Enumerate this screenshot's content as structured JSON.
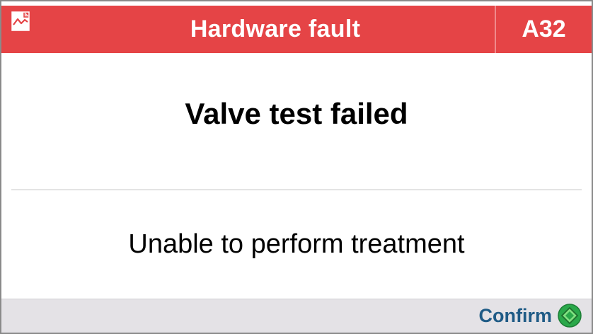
{
  "header": {
    "title": "Hardware fault",
    "code": "A32",
    "icon": "chart-document-icon",
    "color": "#e54446"
  },
  "alarm": {
    "title": "Valve test failed",
    "message": "Unable to perform treatment"
  },
  "footer": {
    "confirm_label": "Confirm",
    "confirm_icon": "green-diamond-start-icon",
    "confirm_color": "#1f5b86",
    "confirm_icon_color": "#2aa84a"
  }
}
